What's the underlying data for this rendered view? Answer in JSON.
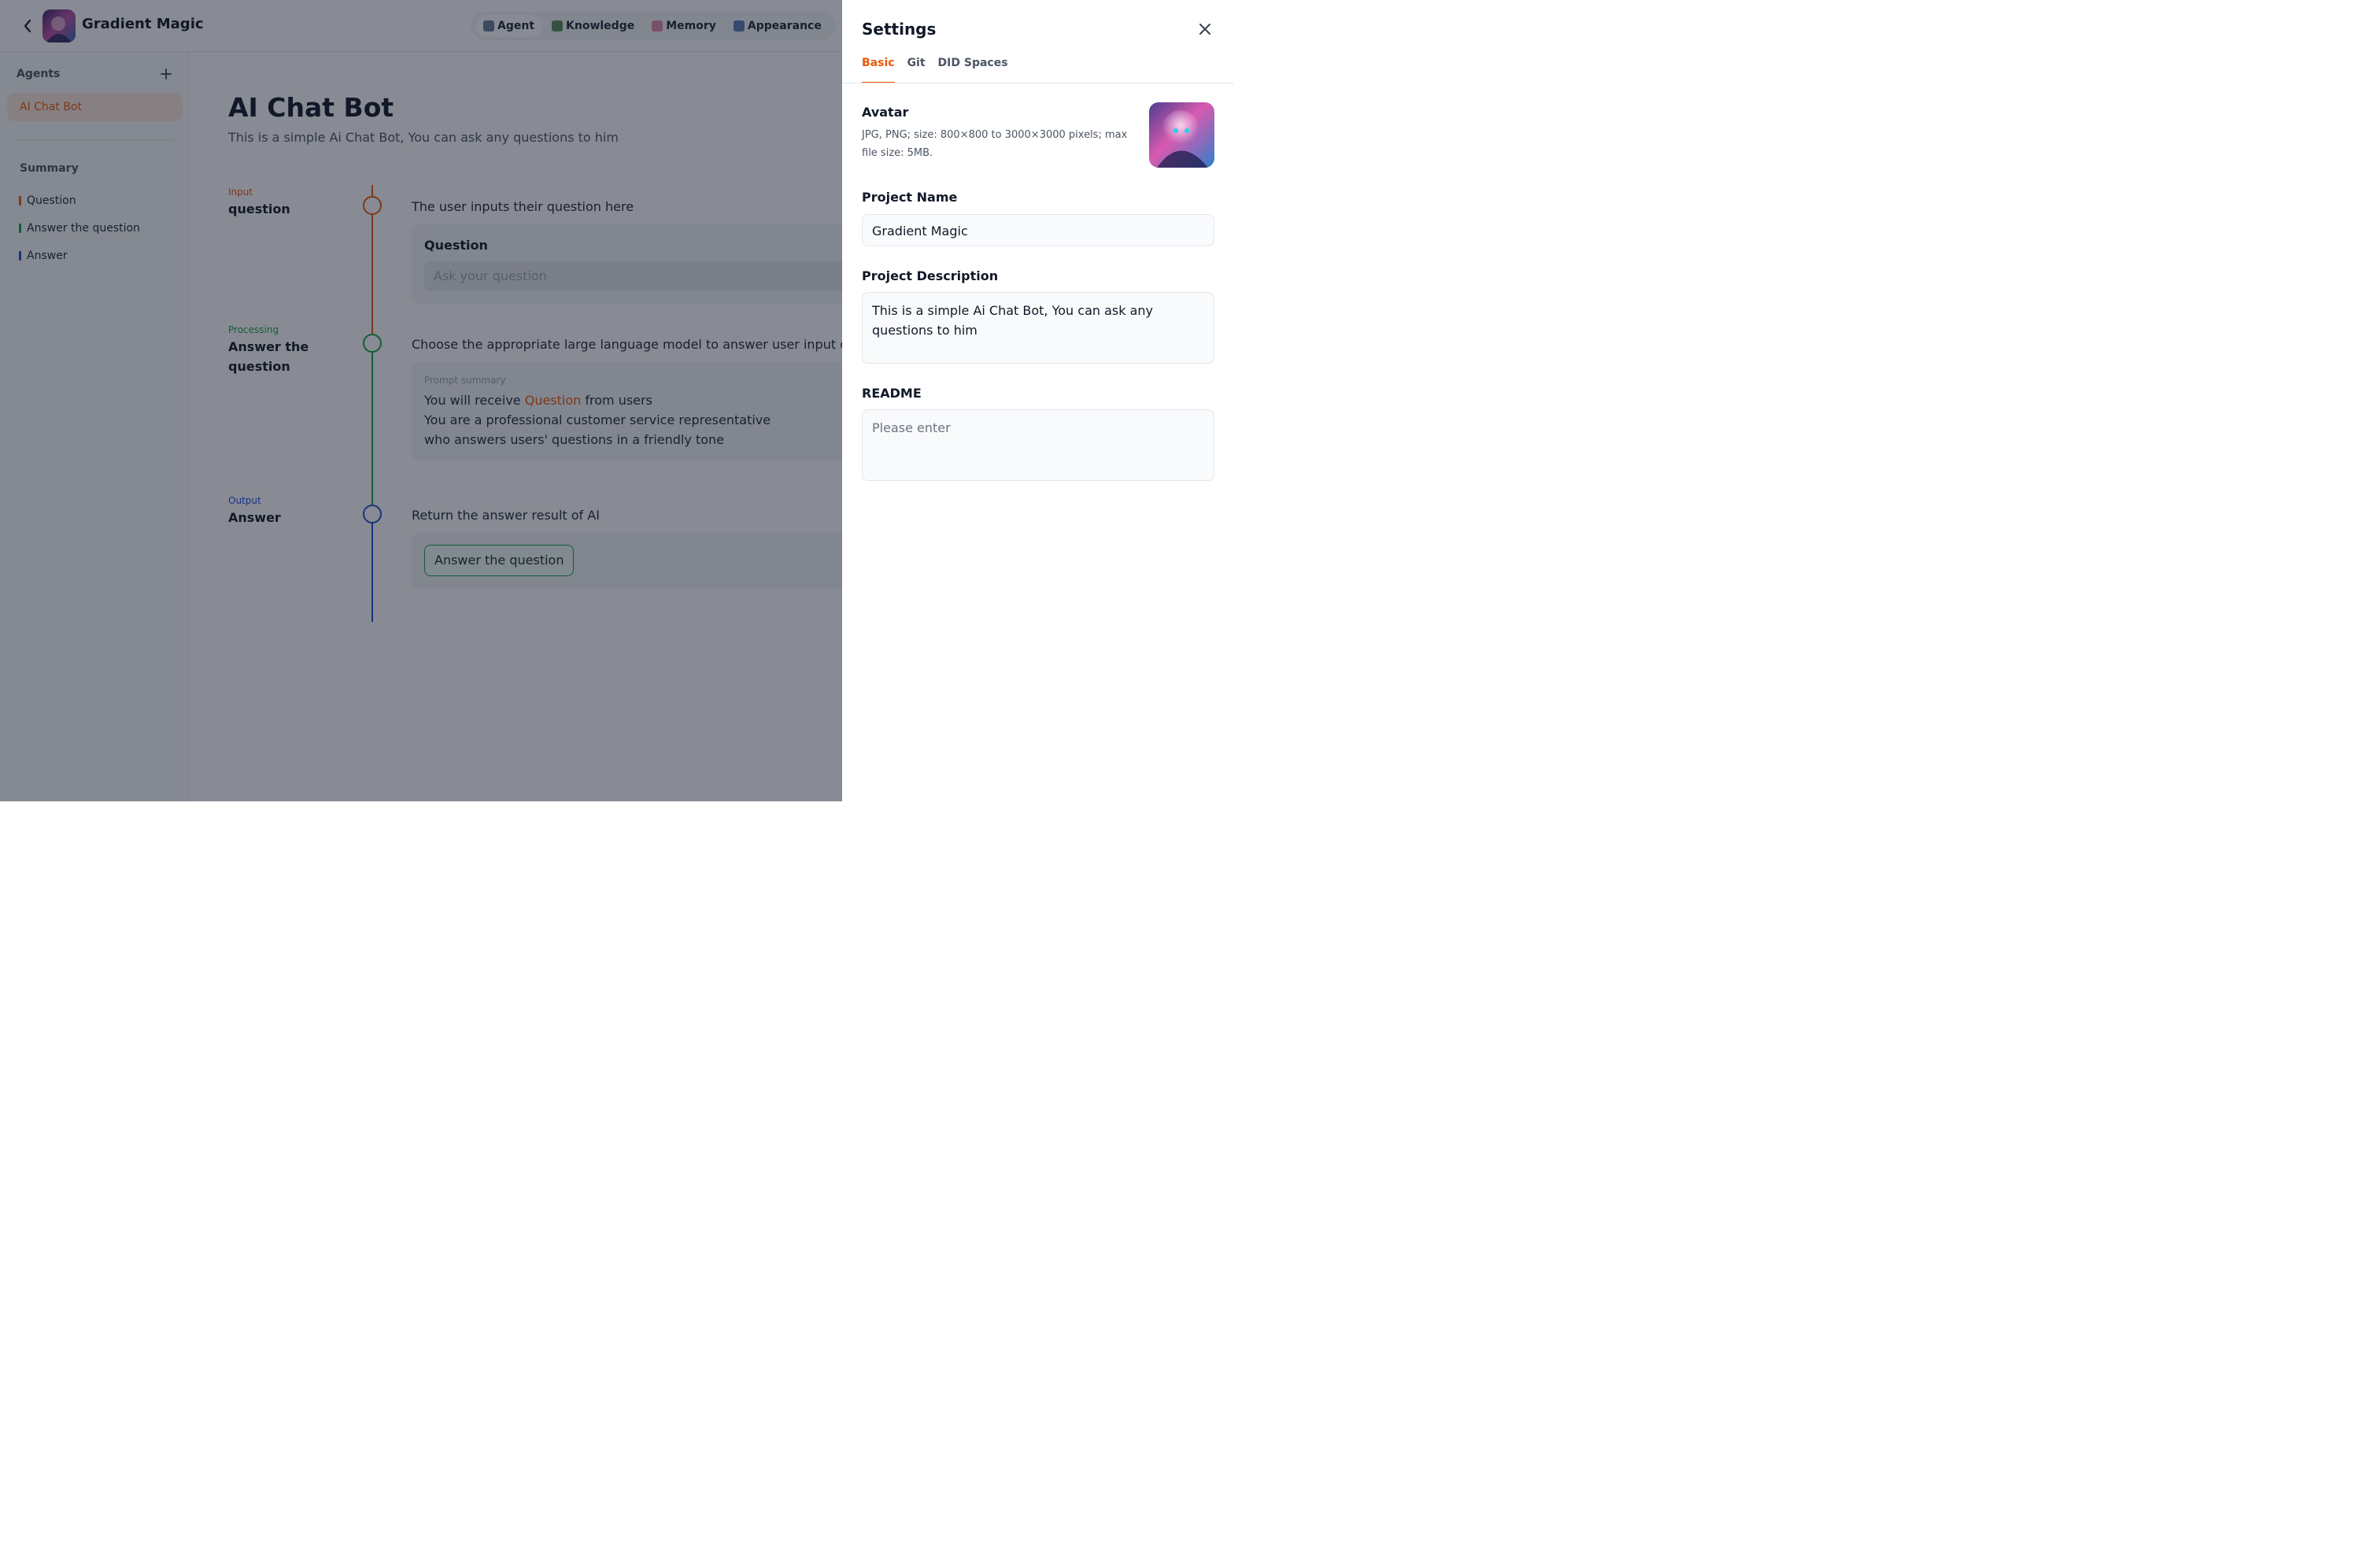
{
  "header": {
    "app_name": "Gradient Magic",
    "nav": [
      {
        "label": "Agent",
        "icon": "robot-icon",
        "color": "#6b7a99"
      },
      {
        "label": "Knowledge",
        "icon": "books-icon",
        "color": "#5b8a5b"
      },
      {
        "label": "Memory",
        "icon": "brain-icon",
        "color": "#e08aa6"
      },
      {
        "label": "Appearance",
        "icon": "palette-icon",
        "color": "#5b7bb8"
      }
    ]
  },
  "sidebar": {
    "agents_label": "Agents",
    "agents": [
      {
        "label": "AI Chat Bot"
      }
    ],
    "summary_label": "Summary",
    "summary_items": [
      {
        "label": "Question",
        "color": "#ea580c"
      },
      {
        "label": "Answer the question",
        "color": "#16a34a"
      },
      {
        "label": "Answer",
        "color": "#1d4ed8"
      }
    ]
  },
  "main": {
    "title": "AI Chat Bot",
    "description": "This is a simple Ai Chat Bot, You can ask any questions to him",
    "steps": [
      {
        "tag": "Input",
        "name": "question",
        "description": "The user inputs their question here",
        "card_label": "Question",
        "input_placeholder": "Ask your question"
      },
      {
        "tag": "Processing",
        "name": "Answer the question",
        "description": "Choose the appropriate large language model to answer user input questions",
        "prompt_heading": "Prompt summary",
        "prompt_line1_before": "You will receive ",
        "prompt_line1_highlight": "Question",
        "prompt_line1_after": " from users",
        "prompt_line2": "You are a professional customer service representative who answers users' questions in a friendly tone"
      },
      {
        "tag": "Output",
        "name": "Answer",
        "description": "Return the answer result of AI",
        "button_label": "Answer the question"
      }
    ]
  },
  "settings": {
    "title": "Settings",
    "tabs": [
      {
        "label": "Basic",
        "active": true
      },
      {
        "label": "Git",
        "active": false
      },
      {
        "label": "DID Spaces",
        "active": false
      }
    ],
    "avatar_label": "Avatar",
    "avatar_hint": "JPG, PNG; size: 800×800 to 3000×3000 pixels; max file size: 5MB.",
    "project_name_label": "Project Name",
    "project_name_value": "Gradient Magic",
    "project_description_label": "Project Description",
    "project_description_value": "This is a simple Ai Chat Bot, You can ask any questions to him",
    "readme_label": "README",
    "readme_placeholder": "Please enter"
  },
  "colors": {
    "accent": "#ea580c",
    "input": "#ea580c",
    "processing": "#16a34a",
    "output": "#1d4ed8"
  }
}
